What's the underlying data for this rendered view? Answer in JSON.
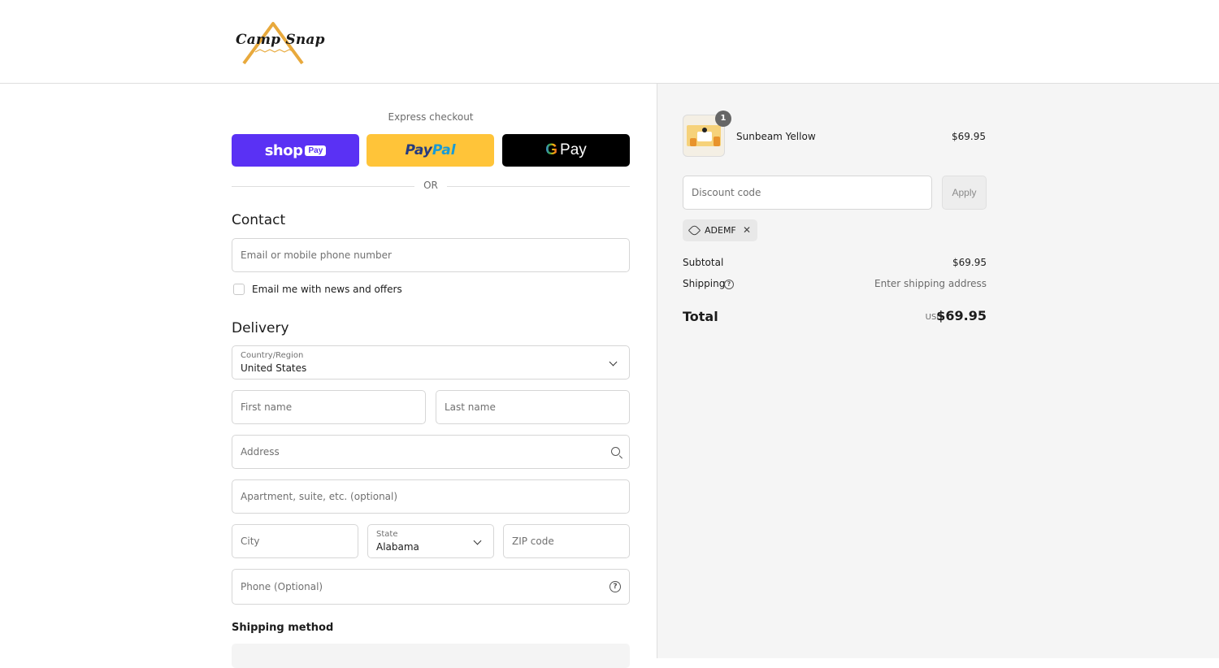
{
  "brand": {
    "logo_text": "Camp Snap"
  },
  "express": {
    "title": "Express checkout",
    "shop_pay": "shop",
    "shop_pay_badge": "Pay",
    "paypal_a": "Pay",
    "paypal_b": "Pal",
    "gpay_g": "G",
    "gpay_word": "Pay"
  },
  "divider": {
    "or": "OR"
  },
  "contact": {
    "title": "Contact",
    "email_placeholder": "Email or mobile phone number",
    "newsletter_label": "Email me with news and offers",
    "newsletter_checked": false
  },
  "delivery": {
    "title": "Delivery",
    "country_label": "Country/Region",
    "country_value": "United States",
    "first_name_placeholder": "First name",
    "last_name_placeholder": "Last name",
    "address_placeholder": "Address",
    "apartment_placeholder": "Apartment, suite, etc. (optional)",
    "city_placeholder": "City",
    "state_label": "State",
    "state_value": "Alabama",
    "zip_placeholder": "ZIP code",
    "phone_placeholder": "Phone (Optional)"
  },
  "shipping_method": {
    "title": "Shipping method"
  },
  "order": {
    "item": {
      "quantity": "1",
      "name": "Sunbeam Yellow",
      "price": "$69.95"
    },
    "discount_placeholder": "Discount code",
    "apply_label": "Apply",
    "applied_code": "ADEMF",
    "subtotal_label": "Subtotal",
    "subtotal_value": "$69.95",
    "shipping_label": "Shipping",
    "shipping_value": "Enter shipping address",
    "total_label": "Total",
    "currency": "USD",
    "total_value": "$69.95"
  },
  "colors": {
    "shop_pay": "#5a31f4",
    "paypal": "#ffc439",
    "gpay": "#000000",
    "summary_bg": "#f5f5f5"
  }
}
